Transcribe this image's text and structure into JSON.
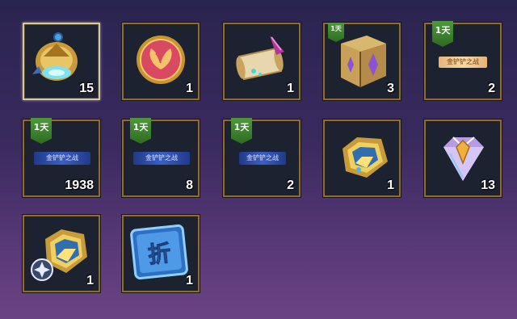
{
  "items": [
    {
      "name": "item-chibi-helmet-orb",
      "count": "15"
    },
    {
      "name": "item-pink-emblem-coin",
      "count": "1"
    },
    {
      "name": "item-scroll-with-feather",
      "count": "1"
    },
    {
      "name": "item-gold-treasure-box",
      "count": "3",
      "badge": "1天"
    },
    {
      "name": "item-event-ticket-gold",
      "count": "2",
      "badge": "1天",
      "ticket": "金铲铲之战"
    },
    {
      "name": "item-event-ticket-blue-1",
      "count": "1938",
      "badge": "1天",
      "ticket": "金铲铲之战"
    },
    {
      "name": "item-event-ticket-blue-2",
      "count": "8",
      "badge": "1天",
      "ticket": "金铲铲之战"
    },
    {
      "name": "item-event-ticket-blue-3",
      "count": "2",
      "badge": "1天",
      "ticket": "金铲铲之战"
    },
    {
      "name": "item-gold-pentagon-token",
      "count": "1"
    },
    {
      "name": "item-crystal-diamond",
      "count": "13"
    },
    {
      "name": "item-pentagon-token-with-coin",
      "count": "1"
    },
    {
      "name": "item-discount-card",
      "count": "1",
      "symbol": "折"
    }
  ],
  "colors": {
    "frame": "#8a6d3a",
    "badge": "#3f8530",
    "ticket_blue": "#2f4fb0",
    "ticket_gold": "#f3cf98"
  }
}
